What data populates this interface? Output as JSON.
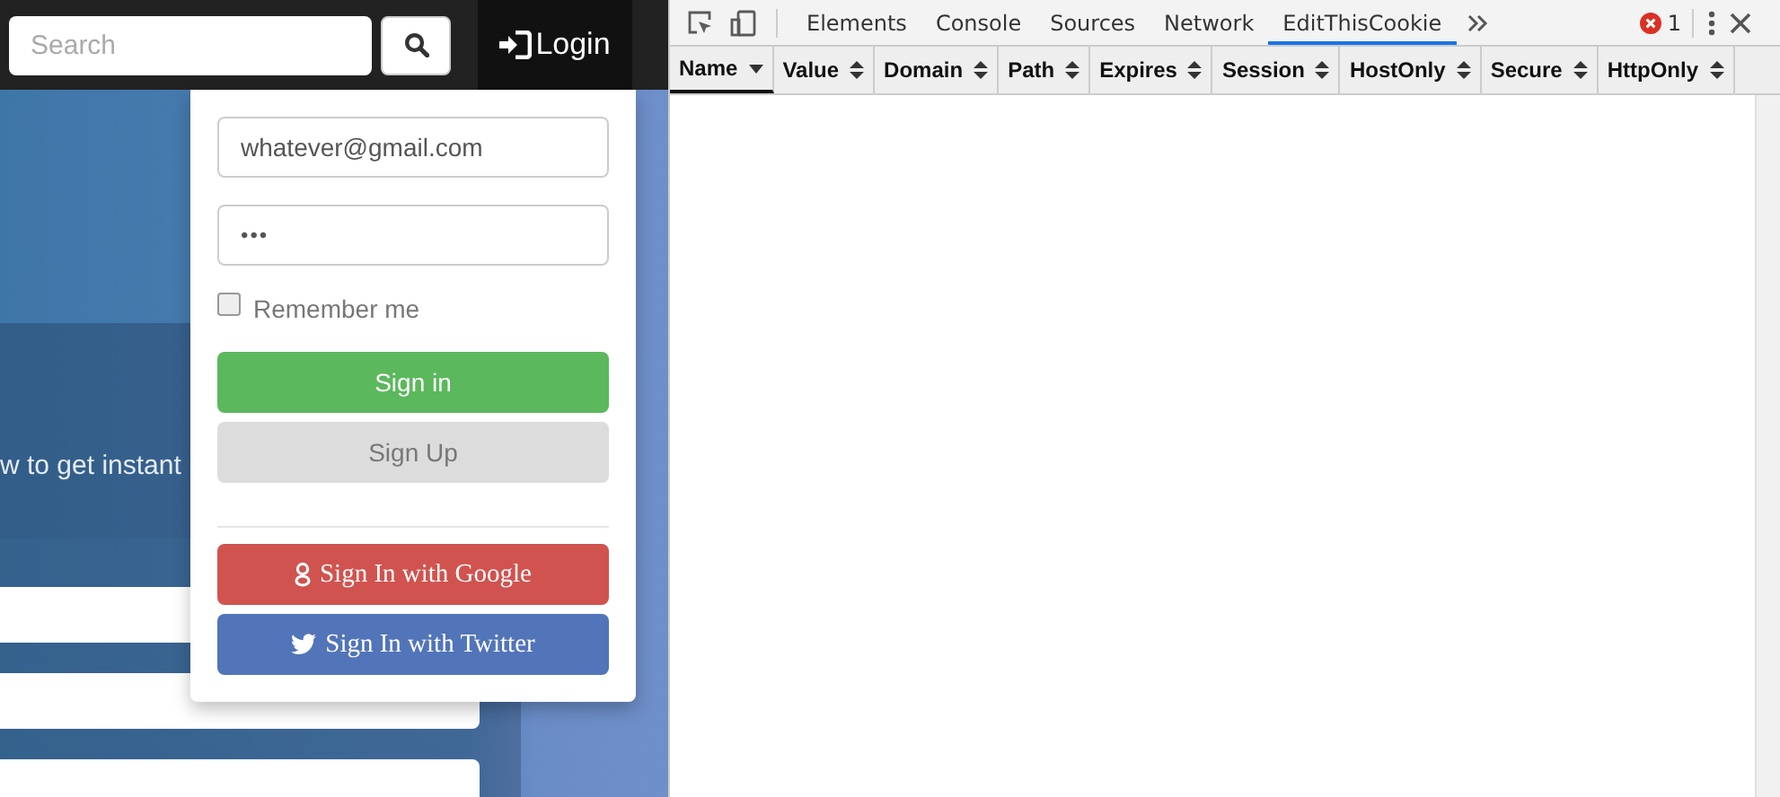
{
  "site": {
    "search": {
      "placeholder": "Search"
    },
    "login_link": "Login",
    "hero_text": "w to get instant",
    "login_form": {
      "email": "whatever@gmail.com",
      "password": "•••",
      "remember": {
        "label": "Remember me",
        "checked": false
      },
      "buttons": [
        {
          "kind": "success",
          "label": "Sign in"
        },
        {
          "kind": "default",
          "label": "Sign Up"
        },
        {
          "kind": "google",
          "label": "Sign In with Google"
        },
        {
          "kind": "twitter",
          "label": "Sign In with Twitter"
        }
      ]
    }
  },
  "devtools": {
    "tabs": [
      {
        "label": "Elements",
        "selected": false
      },
      {
        "label": "Console",
        "selected": false
      },
      {
        "label": "Sources",
        "selected": false
      },
      {
        "label": "Network",
        "selected": false
      },
      {
        "label": "EditThisCookie",
        "selected": true
      }
    ],
    "error_count": "1",
    "table": {
      "columns": [
        {
          "label": "Name",
          "sorted": true
        },
        {
          "label": "Value",
          "sorted": false
        },
        {
          "label": "Domain",
          "sorted": false
        },
        {
          "label": "Path",
          "sorted": false
        },
        {
          "label": "Expires",
          "sorted": false
        },
        {
          "label": "Session",
          "sorted": false
        },
        {
          "label": "HostOnly",
          "sorted": false
        },
        {
          "label": "Secure",
          "sorted": false
        },
        {
          "label": "HttpOnly",
          "sorted": false
        }
      ]
    }
  }
}
